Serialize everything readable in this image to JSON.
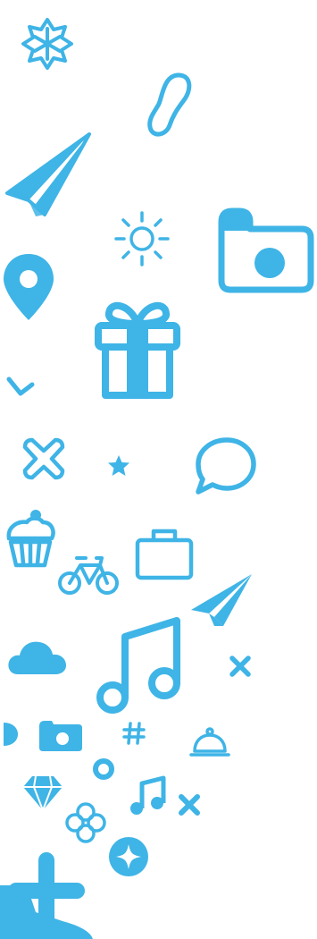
{
  "theme": {
    "accent": "#3fb4e6",
    "background": "#ffffff"
  },
  "icons": [
    "snowflake-badge-icon",
    "footprint-icon",
    "paper-plane-icon",
    "sun-icon",
    "camera-icon",
    "location-pin-icon",
    "gift-icon",
    "chevron-icon",
    "cross-outline-icon",
    "star-icon",
    "speech-bubble-icon",
    "cupcake-icon",
    "briefcase-icon",
    "bicycle-icon",
    "paper-plane-small-icon",
    "cloud-icon",
    "music-note-icon",
    "close-x-icon",
    "half-circle-icon",
    "camera-small-icon",
    "hashtag-icon",
    "cloche-icon",
    "ring-icon",
    "diamond-icon",
    "music-note-small-icon",
    "close-x-small-icon",
    "flower-icon",
    "sparkle-circle-icon",
    "big-plus-icon"
  ]
}
